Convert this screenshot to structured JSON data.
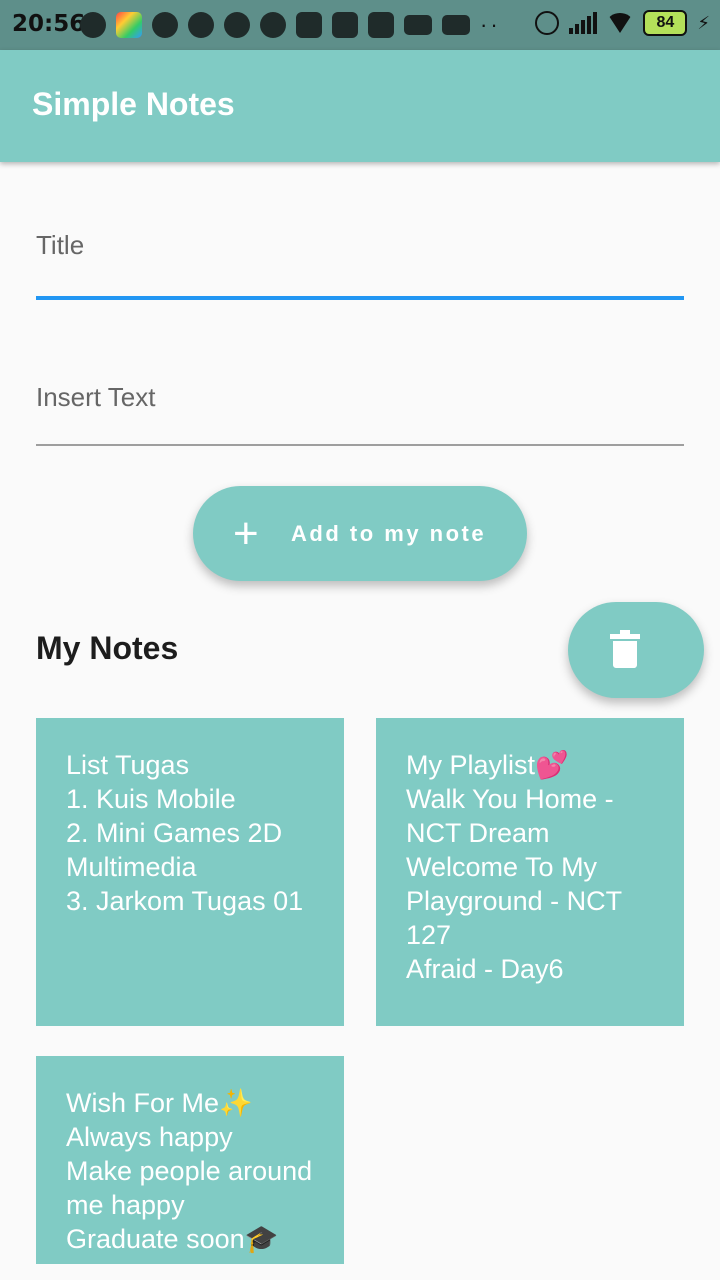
{
  "status_bar": {
    "time": "20:56",
    "battery": "84",
    "notification_icons": [
      "whatsapp-icon",
      "shortcut-icon",
      "chrome-icon",
      "chrome-icon",
      "chrome-icon",
      "chrome-icon",
      "instagram-icon",
      "instagram-icon",
      "n-app-icon",
      "youtube-icon",
      "youtube-icon"
    ]
  },
  "app_bar": {
    "title": "Simple Notes",
    "color": "#80cbc4"
  },
  "form": {
    "title_placeholder": "Title",
    "text_placeholder": "Insert Text",
    "add_button_label": "Add to my note"
  },
  "notes_section": {
    "title": "My Notes"
  },
  "notes": [
    {
      "text": "List Tugas\n1. Kuis Mobile\n2. Mini Games 2D Multimedia\n3. Jarkom Tugas 01"
    },
    {
      "text": "My Playlist💕\nWalk You Home - NCT Dream\nWelcome To My Playground - NCT 127\nAfraid - Day6"
    },
    {
      "text": "Wish For Me✨\nAlways happy\nMake people around me happy\nGraduate soon🎓"
    }
  ],
  "colors": {
    "accent": "#80cbc4",
    "focus_underline": "#2196f3"
  }
}
